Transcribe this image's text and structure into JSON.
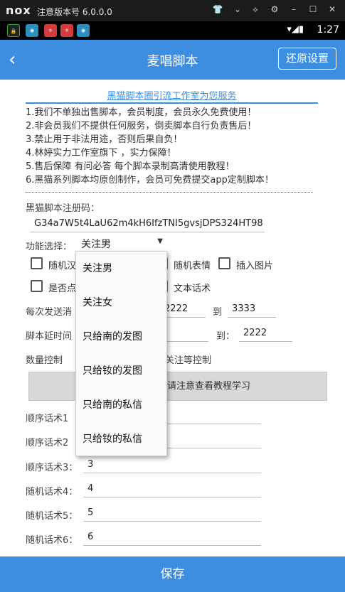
{
  "emulator": {
    "logo": "nox",
    "title": "注意版本号 6.0.0.0",
    "controls": [
      "shirt-icon",
      "chevron-down-icon",
      "pin-icon",
      "gear-icon",
      "minimize-icon",
      "maximize-icon",
      "close-icon"
    ],
    "control_glyphs": [
      "👕",
      "⌄",
      "⟡",
      "⚙",
      "–",
      "☐",
      "✕"
    ]
  },
  "status_bar": {
    "time": "1:27",
    "notification_icons": [
      {
        "name": "lock-app-icon",
        "text": "🔒",
        "color": "#1b1b1b"
      },
      {
        "name": "browser-icon",
        "text": "◉",
        "color": "#2a8fbf"
      },
      {
        "name": "red-app-icon",
        "text": "ㅎ",
        "color": "#d13c3c"
      },
      {
        "name": "red-app-icon-2",
        "text": "ㅎ",
        "color": "#d13c3c"
      },
      {
        "name": "browser-icon-2",
        "text": "◉",
        "color": "#2a8fbf"
      }
    ],
    "system_icons": "▾◢▮"
  },
  "app_bar": {
    "back": "‹",
    "title": "麦唱脚本",
    "restore_button": "还原设置"
  },
  "banner": "黑猫脚本圈引流工作室为您服务",
  "notice_lines": [
    "1.我们不单独出售脚本，会员制度，会员永久免费使用！",
    "2.非会员我们不提供任何服务，倒卖脚本自行负责售后！",
    "3.禁止用于非法用途，否则后果自负！",
    "4.林婷实力工作室旗下 ，实力保障！",
    "5.售后保障 有问必答 每个脚本录制高清使用教程！",
    "6.黑猫系列脚本均原创制作，会员可免费提交app定制脚本！"
  ],
  "reg": {
    "label": "黑猫脚本注册码：",
    "value": "G34a7W5t4LaU62m4kH6IfzTNI5gvsjDPS324HT98"
  },
  "func": {
    "label": "功能选择：",
    "selected": "关注男",
    "options": [
      "关注男",
      "关注女",
      "只给南的发图",
      "只给钕的发图",
      "只给南的私信",
      "只给钕的私信"
    ]
  },
  "checkboxes": [
    {
      "label": "随机汉",
      "checked": false
    },
    {
      "label": "随机表情",
      "checked": true
    },
    {
      "label": "插入图片",
      "checked": false
    },
    {
      "label": "是否点",
      "checked": false
    },
    {
      "label": "文本话术",
      "checked": true
    }
  ],
  "send_range": {
    "label": "每次发送消",
    "from": "2222",
    "to_label": "到",
    "to": "3333"
  },
  "delay": {
    "label": "脚本延时间",
    "to_label": "到：",
    "to": "2222"
  },
  "qty": {
    "label": "数量控制",
    "hint": "关注等控制"
  },
  "tutorial_button": "请注意查看教程学习",
  "scripts": [
    {
      "label": "顺序话术1",
      "value": ""
    },
    {
      "label": "顺序话术2",
      "value": ""
    },
    {
      "label": "顺序话术3：",
      "value": "3"
    },
    {
      "label": "随机话术4：",
      "value": "4"
    },
    {
      "label": "随机话术5：",
      "value": "5"
    },
    {
      "label": "随机话术6：",
      "value": "6"
    }
  ],
  "save_button": "保存"
}
